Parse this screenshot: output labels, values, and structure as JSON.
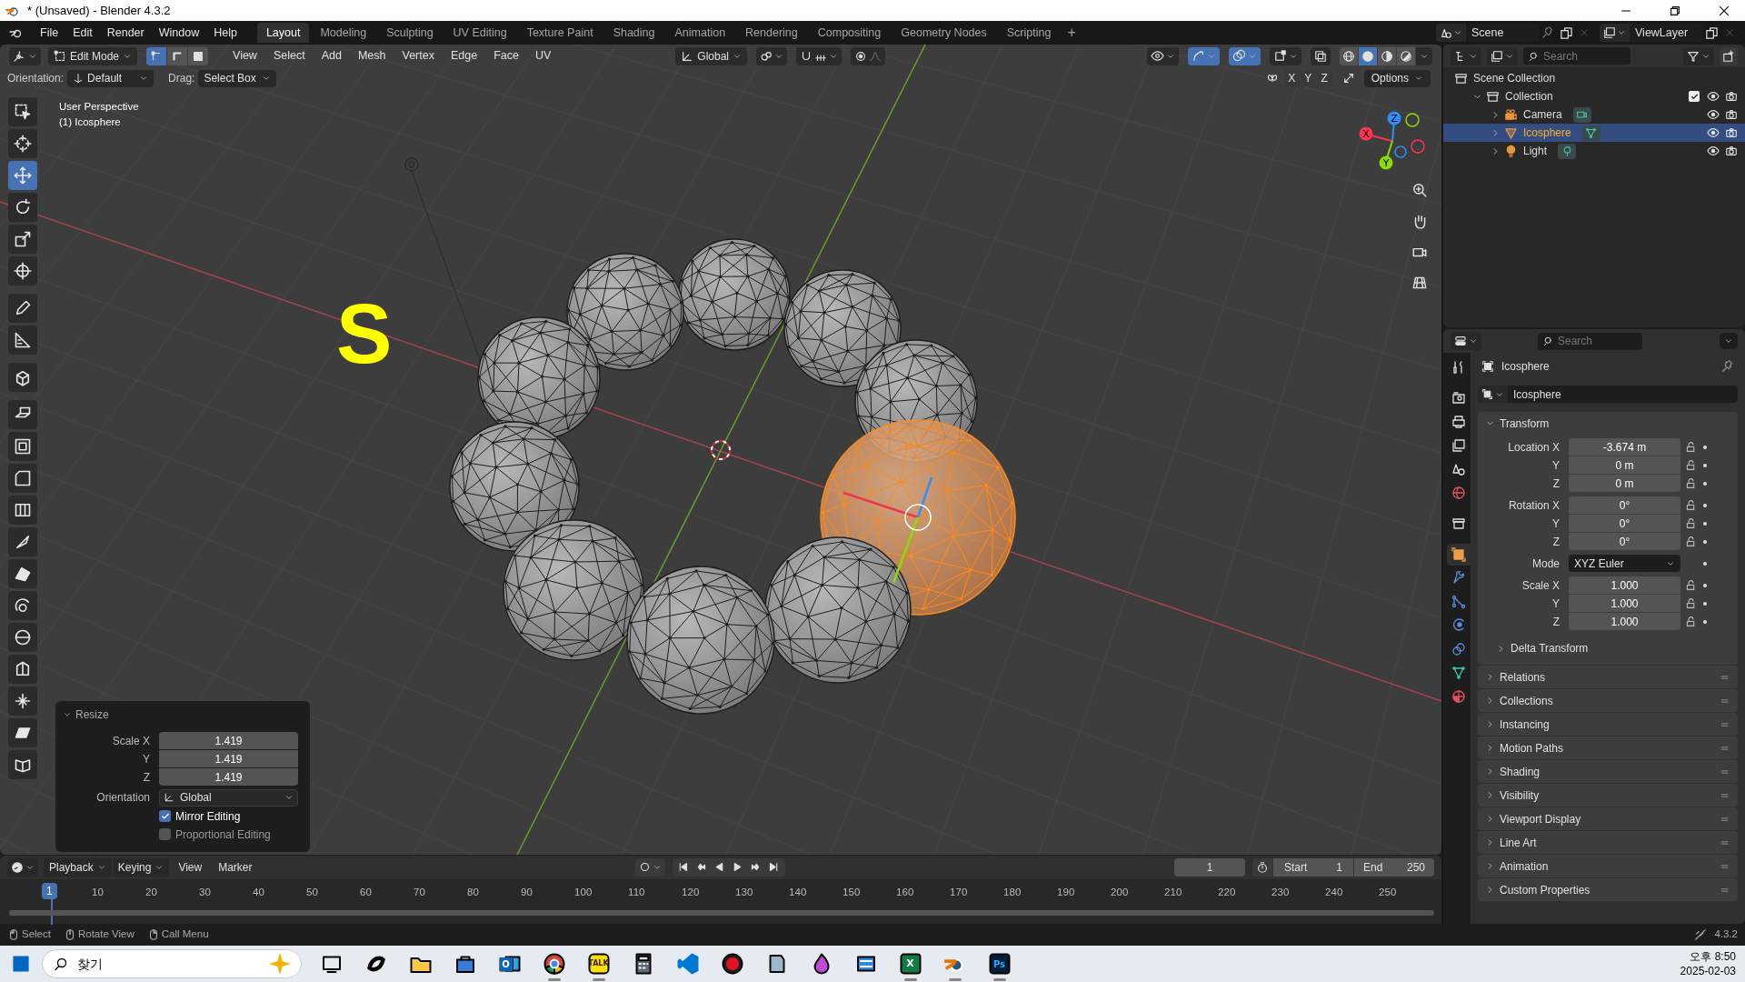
{
  "window": {
    "title": "* (Unsaved) - Blender 4.3.2"
  },
  "top_bar": {
    "menus": [
      "File",
      "Edit",
      "Render",
      "Window",
      "Help"
    ],
    "workspaces": [
      {
        "label": "Layout",
        "selected": true
      },
      {
        "label": "Modeling",
        "selected": false
      },
      {
        "label": "Sculpting",
        "selected": false
      },
      {
        "label": "UV Editing",
        "selected": false
      },
      {
        "label": "Texture Paint",
        "selected": false
      },
      {
        "label": "Shading",
        "selected": false
      },
      {
        "label": "Animation",
        "selected": false
      },
      {
        "label": "Rendering",
        "selected": false
      },
      {
        "label": "Compositing",
        "selected": false
      },
      {
        "label": "Geometry Nodes",
        "selected": false
      },
      {
        "label": "Scripting",
        "selected": false
      }
    ],
    "add_workspace": "+",
    "scene": "Scene",
    "view_layer": "ViewLayer"
  },
  "viewport_header": {
    "mode": "Edit Mode",
    "select_modes": [
      {
        "kind": "vertex",
        "selected": true
      },
      {
        "kind": "edge",
        "selected": false
      },
      {
        "kind": "face",
        "selected": false
      }
    ],
    "menus": [
      "View",
      "Select",
      "Add",
      "Mesh",
      "Vertex",
      "Edge",
      "Face",
      "UV"
    ],
    "transform_orientation": "Global",
    "snapping": {
      "on": false
    },
    "proportional": {
      "on": false
    },
    "gizmos": {
      "on": true
    },
    "overlays": {
      "on": true
    },
    "shading": [
      {
        "kind": "wireframe",
        "selected": false
      },
      {
        "kind": "solid",
        "selected": true
      },
      {
        "kind": "material",
        "selected": false
      },
      {
        "kind": "rendered",
        "selected": false
      }
    ]
  },
  "tool_settings": {
    "orientation_label": "Orientation:",
    "orientation": "Default",
    "drag_label": "Drag:",
    "drag": "Select Box",
    "mirror_axes": [
      {
        "label": "X",
        "selected": false
      },
      {
        "label": "Y",
        "selected": false
      },
      {
        "label": "Z",
        "selected": false
      }
    ],
    "options": "Options"
  },
  "toolbar": [
    {
      "kind": "select",
      "selected": false
    },
    {
      "kind": "cursor",
      "selected": false
    },
    {
      "kind": "move",
      "selected": true
    },
    {
      "kind": "rotate",
      "selected": false
    },
    {
      "kind": "scale",
      "selected": false
    },
    {
      "kind": "transform",
      "selected": false
    },
    {
      "kind": "annotate",
      "selected": false
    },
    {
      "kind": "measure",
      "selected": false
    },
    {
      "kind": "add_cube",
      "selected": false
    },
    {
      "kind": "extrude",
      "selected": false
    },
    {
      "kind": "inset",
      "selected": false
    },
    {
      "kind": "bevel",
      "selected": false
    },
    {
      "kind": "loopcut",
      "selected": false
    },
    {
      "kind": "knife",
      "selected": false
    },
    {
      "kind": "polybuild",
      "selected": false
    },
    {
      "kind": "spin",
      "selected": false
    },
    {
      "kind": "smooth",
      "selected": false
    },
    {
      "kind": "edge_slide",
      "selected": false
    },
    {
      "kind": "shrink",
      "selected": false
    },
    {
      "kind": "shear",
      "selected": false
    },
    {
      "kind": "rip",
      "selected": false
    }
  ],
  "viewport": {
    "info": [
      "User Perspective",
      "(1) Icosphere"
    ],
    "key_overlay": "S",
    "gizmo_labels": [
      "X",
      "Y",
      "Z"
    ]
  },
  "resize_panel": {
    "title": "Resize",
    "fields": [
      {
        "label": "Scale X",
        "value": "1.419"
      },
      {
        "label": "Y",
        "value": "1.419"
      },
      {
        "label": "Z",
        "value": "1.419"
      }
    ],
    "orientation_label": "Orientation",
    "orientation": "Global",
    "checkboxes": [
      {
        "label": "Mirror Editing",
        "checked": true
      },
      {
        "label": "Proportional Editing",
        "checked": false
      }
    ]
  },
  "timeline": {
    "menus": [
      "Playback",
      "Keying",
      "View",
      "Marker"
    ],
    "auto_keying": {
      "on": false
    },
    "current_frame": "1",
    "start_label": "Start",
    "start": "1",
    "end_label": "End",
    "end": "250",
    "ruler": [
      "1",
      "10",
      "20",
      "30",
      "40",
      "50",
      "60",
      "70",
      "80",
      "90",
      "100",
      "110",
      "120",
      "130",
      "140",
      "150",
      "160",
      "170",
      "180",
      "190",
      "200",
      "210",
      "220",
      "230",
      "240",
      "250"
    ]
  },
  "outliner": {
    "search_placeholder": "Search",
    "tree": [
      {
        "label": "Scene Collection",
        "kind": "scene_collection",
        "selected": false,
        "children": [
          {
            "label": "Collection",
            "kind": "collection",
            "selected": false,
            "expanded": true,
            "checked": true,
            "children": [
              {
                "label": "Camera",
                "kind": "camera",
                "selected": false,
                "expanded": false
              },
              {
                "label": "Icosphere",
                "kind": "mesh",
                "selected": true,
                "expanded": false
              },
              {
                "label": "Light",
                "kind": "light",
                "selected": false,
                "expanded": false
              }
            ]
          }
        ]
      }
    ]
  },
  "properties": {
    "search_placeholder": "Search",
    "tabs": [
      {
        "kind": "tool",
        "selected": false
      },
      {
        "kind": "render",
        "selected": false
      },
      {
        "kind": "output",
        "selected": false
      },
      {
        "kind": "view_layer",
        "selected": false
      },
      {
        "kind": "scene",
        "selected": false
      },
      {
        "kind": "world",
        "selected": false
      },
      {
        "kind": "collection",
        "selected": false
      },
      {
        "kind": "object",
        "selected": true
      },
      {
        "kind": "modifiers",
        "selected": false
      },
      {
        "kind": "particles",
        "selected": false
      },
      {
        "kind": "physics",
        "selected": false
      },
      {
        "kind": "constraints",
        "selected": false
      },
      {
        "kind": "data",
        "selected": false
      },
      {
        "kind": "material",
        "selected": false
      }
    ],
    "object_name": "Icosphere",
    "name_field": "Icosphere",
    "transform": {
      "title": "Transform",
      "expanded": true,
      "groups": [
        [
          {
            "label": "Location X",
            "value": "-3.674 m",
            "kind": "number"
          },
          {
            "label": "Y",
            "value": "0 m",
            "kind": "number"
          },
          {
            "label": "Z",
            "value": "0 m",
            "kind": "number"
          }
        ],
        [
          {
            "label": "Rotation X",
            "value": "0°",
            "kind": "number"
          },
          {
            "label": "Y",
            "value": "0°",
            "kind": "number"
          },
          {
            "label": "Z",
            "value": "0°",
            "kind": "number"
          }
        ],
        [
          {
            "label": "Mode",
            "value": "XYZ Euler",
            "kind": "dropdown"
          }
        ],
        [
          {
            "label": "Scale X",
            "value": "1.000",
            "kind": "number"
          },
          {
            "label": "Y",
            "value": "1.000",
            "kind": "number"
          },
          {
            "label": "Z",
            "value": "1.000",
            "kind": "number"
          }
        ]
      ],
      "subpanel": {
        "title": "Delta Transform",
        "expanded": false
      }
    },
    "panels": [
      {
        "title": "Relations",
        "expanded": false
      },
      {
        "title": "Collections",
        "expanded": false
      },
      {
        "title": "Instancing",
        "expanded": false
      },
      {
        "title": "Motion Paths",
        "expanded": false
      },
      {
        "title": "Shading",
        "expanded": false
      },
      {
        "title": "Visibility",
        "expanded": false
      },
      {
        "title": "Viewport Display",
        "expanded": false
      },
      {
        "title": "Line Art",
        "expanded": false
      },
      {
        "title": "Animation",
        "expanded": false
      },
      {
        "title": "Custom Properties",
        "expanded": false
      }
    ]
  },
  "status_bar": {
    "hints": [
      {
        "kind": "lmb",
        "label": "Select"
      },
      {
        "kind": "mmb",
        "label": "Rotate View"
      },
      {
        "kind": "rmb",
        "label": "Call Menu"
      }
    ],
    "version": "4.3.2"
  },
  "taskbar": {
    "search_placeholder": "찾기",
    "apps": [
      {
        "kind": "task_view",
        "running": false
      },
      {
        "kind": "copilot",
        "running": false
      },
      {
        "kind": "files",
        "running": false
      },
      {
        "kind": "store",
        "running": false
      },
      {
        "kind": "outlook",
        "label": "O",
        "running": false
      },
      {
        "kind": "chrome",
        "running": true
      },
      {
        "kind": "kakaotalk",
        "label": "TALK",
        "running": true
      },
      {
        "kind": "calculator",
        "running": false
      },
      {
        "kind": "vscode",
        "running": false
      },
      {
        "kind": "recorder",
        "running": false
      },
      {
        "kind": "notes",
        "running": false
      },
      {
        "kind": "paint",
        "running": false
      },
      {
        "kind": "snip",
        "running": false
      },
      {
        "kind": "excel",
        "label": "X",
        "running": true
      },
      {
        "kind": "blender",
        "running": true
      },
      {
        "kind": "photoshop",
        "label": "Ps",
        "running": true
      }
    ],
    "time": "오후 8:50",
    "date": "2025-02-03"
  }
}
